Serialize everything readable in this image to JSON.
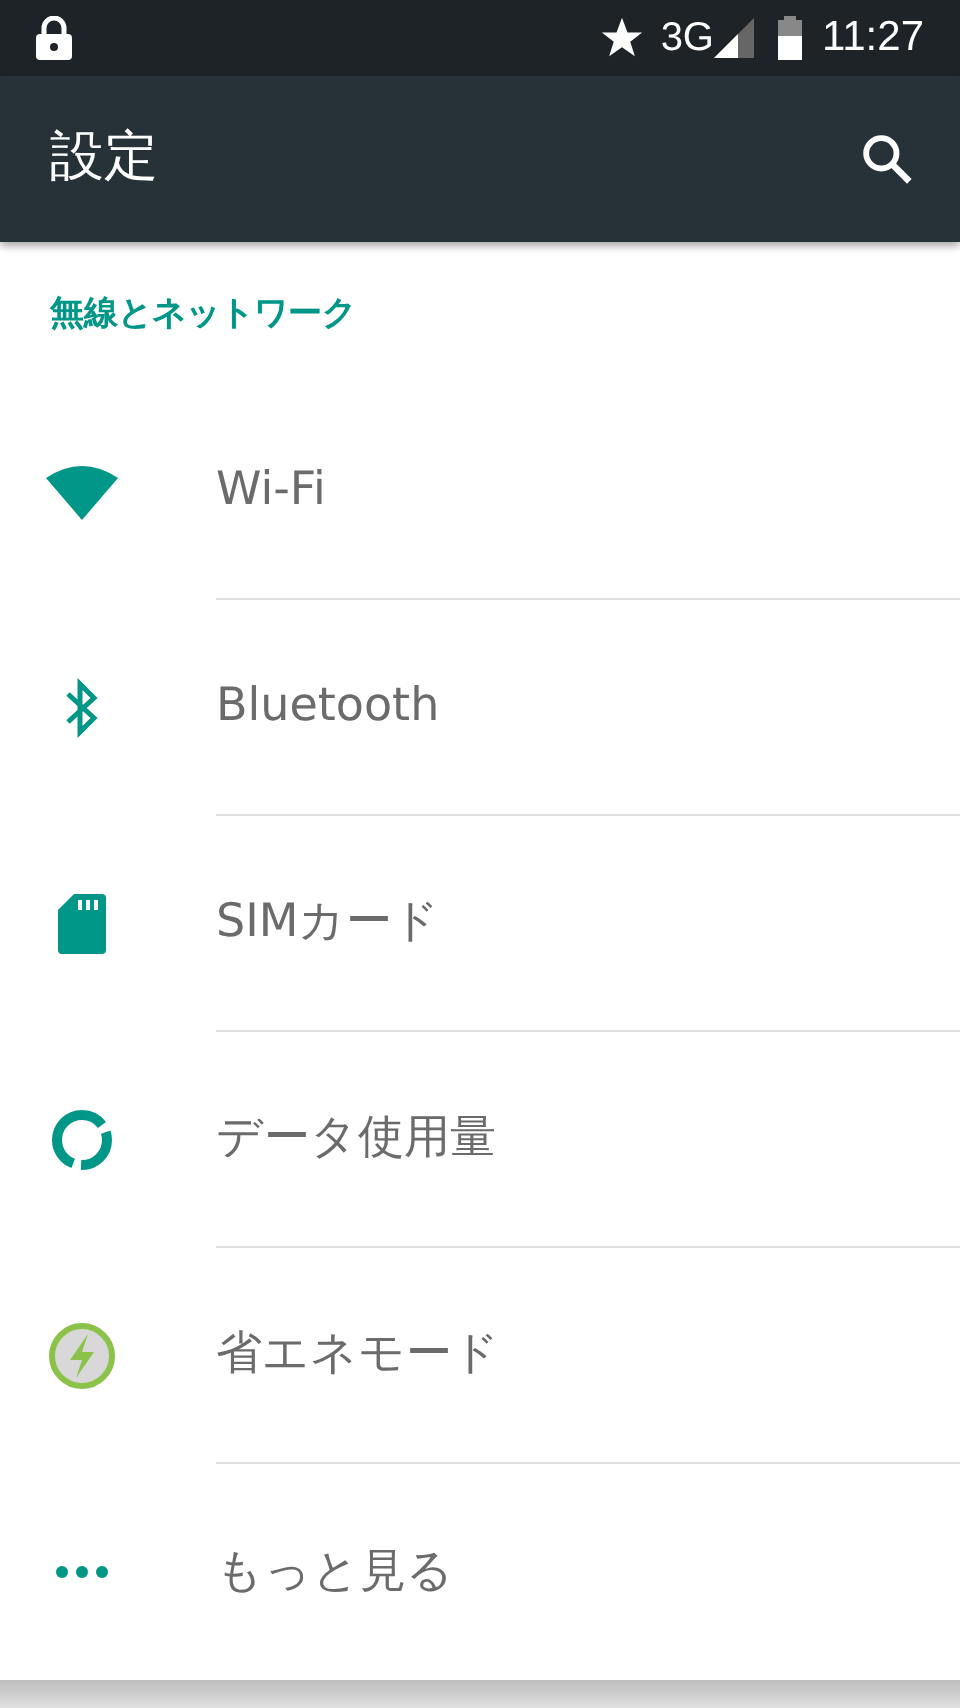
{
  "status_bar": {
    "network": "3G",
    "time": "11:27"
  },
  "app_bar": {
    "title": "設定"
  },
  "section": {
    "title": "無線とネットワーク"
  },
  "items": [
    {
      "kind": "wifi",
      "label": "Wi-Fi"
    },
    {
      "kind": "bluetooth",
      "label": "Bluetooth"
    },
    {
      "kind": "sim",
      "label": "SIMカード"
    },
    {
      "kind": "data",
      "label": "データ使用量"
    },
    {
      "kind": "power",
      "label": "省エネモード"
    },
    {
      "kind": "more",
      "label": "もっと見る"
    }
  ]
}
